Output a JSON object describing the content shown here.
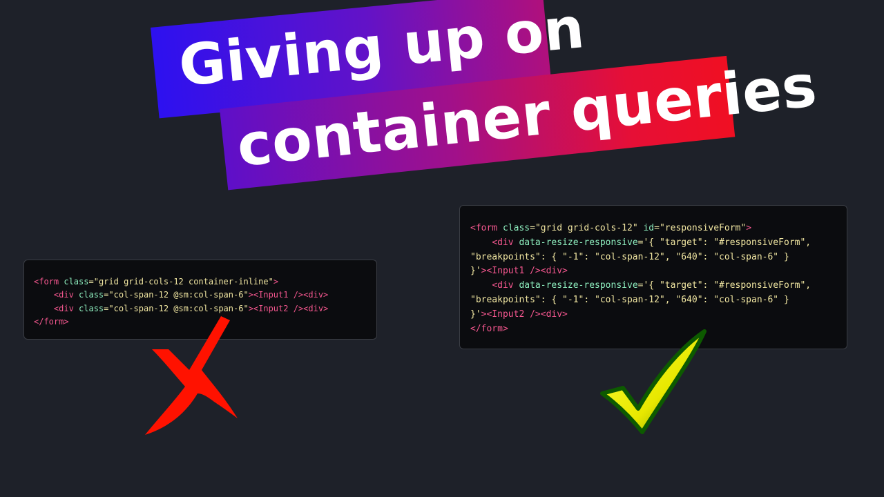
{
  "title": {
    "line1": "Giving up on",
    "line2": "container queries"
  },
  "left_code": {
    "lines": [
      [
        {
          "t": "tag",
          "v": "<form "
        },
        {
          "t": "attr",
          "v": "class"
        },
        {
          "t": "eq",
          "v": "="
        },
        {
          "t": "str",
          "v": "\"grid grid-cols-12 container-inline\""
        },
        {
          "t": "tag",
          "v": ">"
        }
      ],
      [
        {
          "t": "eq",
          "v": "    "
        },
        {
          "t": "tag",
          "v": "<div "
        },
        {
          "t": "attr",
          "v": "class"
        },
        {
          "t": "eq",
          "v": "="
        },
        {
          "t": "str",
          "v": "\"col-span-12 @sm:col-span-6\""
        },
        {
          "t": "tag",
          "v": "><Input1 /><div>"
        }
      ],
      [
        {
          "t": "eq",
          "v": "    "
        },
        {
          "t": "tag",
          "v": "<div "
        },
        {
          "t": "attr",
          "v": "class"
        },
        {
          "t": "eq",
          "v": "="
        },
        {
          "t": "str",
          "v": "\"col-span-12 @sm:col-span-6\""
        },
        {
          "t": "tag",
          "v": "><Input2 /><div>"
        }
      ],
      [
        {
          "t": "tag",
          "v": "</form>"
        }
      ]
    ]
  },
  "right_code": {
    "lines": [
      [
        {
          "t": "tag",
          "v": "<form "
        },
        {
          "t": "attr",
          "v": "class"
        },
        {
          "t": "eq",
          "v": "="
        },
        {
          "t": "str",
          "v": "\"grid grid-cols-12\""
        },
        {
          "t": "eq",
          "v": " "
        },
        {
          "t": "attr",
          "v": "id"
        },
        {
          "t": "eq",
          "v": "="
        },
        {
          "t": "str",
          "v": "\"responsiveForm\""
        },
        {
          "t": "tag",
          "v": ">"
        }
      ],
      [
        {
          "t": "eq",
          "v": "    "
        },
        {
          "t": "tag",
          "v": "<div "
        },
        {
          "t": "attr",
          "v": "data-resize-responsive"
        },
        {
          "t": "eq",
          "v": "="
        },
        {
          "t": "str",
          "v": "'{ \"target\": \"#responsiveForm\","
        }
      ],
      [
        {
          "t": "str",
          "v": "\"breakpoints\": { \"-1\": \"col-span-12\", \"640\": \"col-span-6\" }"
        }
      ],
      [
        {
          "t": "str",
          "v": "}'"
        },
        {
          "t": "tag",
          "v": "><Input1 /><div>"
        }
      ],
      [
        {
          "t": "eq",
          "v": "    "
        },
        {
          "t": "tag",
          "v": "<div "
        },
        {
          "t": "attr",
          "v": "data-resize-responsive"
        },
        {
          "t": "eq",
          "v": "="
        },
        {
          "t": "str",
          "v": "'{ \"target\": \"#responsiveForm\","
        }
      ],
      [
        {
          "t": "str",
          "v": "\"breakpoints\": { \"-1\": \"col-span-12\", \"640\": \"col-span-6\" }"
        }
      ],
      [
        {
          "t": "str",
          "v": "}'"
        },
        {
          "t": "tag",
          "v": "><Input2 /><div>"
        }
      ],
      [
        {
          "t": "tag",
          "v": "</form>"
        }
      ]
    ]
  },
  "icons": {
    "cross": "red-cross-icon",
    "check": "yellow-checkmark-icon"
  },
  "colors": {
    "background": "#1e2129",
    "tag": "#f5578f",
    "attr": "#8ff0c0",
    "string": "#f2e7a2",
    "cross": "#ff1200",
    "check_fill": "#f2f20a",
    "check_outline": "#0d5a00"
  }
}
